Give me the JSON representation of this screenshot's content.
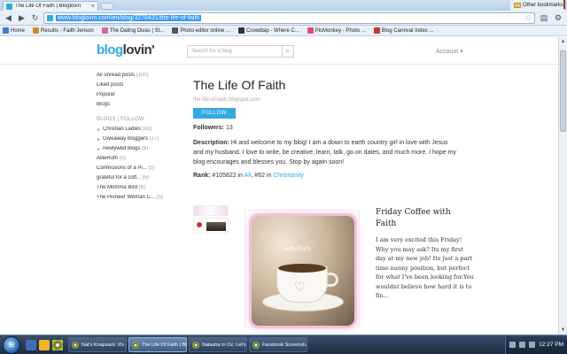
{
  "browser": {
    "tab_title": "The Life Of Faith | Bloglovin",
    "url": "www.bloglovin.com/en/blog/3278431/the-life-of-faith",
    "bookmarks": [
      {
        "label": "Home",
        "color": "#3b7bd6"
      },
      {
        "label": "Results - Faith Jenson",
        "color": "#d0892b"
      },
      {
        "label": "The Dating Divas | St...",
        "color": "#c86ea0"
      },
      {
        "label": "Photo editor online ...",
        "color": "#555555"
      },
      {
        "label": "Crowdtap - Where C...",
        "color": "#333333"
      },
      {
        "label": "PicMonkey - Photo ...",
        "color": "#e24a7a"
      },
      {
        "label": "Blog Carnival Index ...",
        "color": "#c0392b"
      }
    ],
    "other_bookmarks": "Other bookmarks"
  },
  "header": {
    "logo_part1": "blog",
    "logo_part2": "lovin'",
    "search_placeholder": "Search for a blog",
    "account": "Account ▾"
  },
  "sidebar": {
    "items": [
      {
        "label": "All unread posts",
        "count": "(100)"
      },
      {
        "label": "Liked posts",
        "count": ""
      },
      {
        "label": "Popular",
        "count": ""
      },
      {
        "label": "Blogs",
        "count": ""
      }
    ],
    "section_title": "BLOGS | FOLLOW",
    "folders": [
      {
        "label": "Christian Ladies",
        "count": "(63)"
      },
      {
        "label": "Giveaway bloggers",
        "count": "(17)"
      },
      {
        "label": "newlywed blogs",
        "count": "(6)"
      }
    ],
    "blogs": [
      {
        "label": "AllieRuth",
        "count": "(5)"
      },
      {
        "label": "Confessions of a Pi...",
        "count": "(5)"
      },
      {
        "label": "grateful for a coff...",
        "count": "(5)"
      },
      {
        "label": "The Momma Bird",
        "count": "(6)"
      },
      {
        "label": "The Pioneer Woman C...",
        "count": "(5)"
      }
    ]
  },
  "blog": {
    "title": "The Life Of Faith",
    "url": "the-life-of-faith.blogspot.com",
    "follow_label": "FOLLOW",
    "followers_label": "Followers:",
    "followers_count": "13",
    "description_label": "Description:",
    "description": "Hi and welcome to my blog! I am a down to earth country girl in love with Jesus and my husband. I love to write, be creative, learn, talk, go on dates, and much more. I hope my blog encourages and blesses you. Stop by again soon!",
    "rank_label": "Rank:",
    "rank_value": "#105822 in",
    "rank_all": "All",
    "rank_sep": ", #62 in",
    "rank_category": "Christianity"
  },
  "post": {
    "image_caption": "with Faith",
    "title": "Friday Coffee with Faith",
    "excerpt": "I am very excited this Friday! Why you may ask? Its my first day at my new job! Its just a part time nanny position, but perfect for what I've been looking for.You wouldnt believe how hard it is to fin..."
  },
  "taskbar": {
    "tasks": [
      "Nat's Knapsack: It's a...",
      "The Life Of Faith | Bl...",
      "Natasha In Oz: Let's ...",
      "Facebook Screensh..."
    ],
    "clock": "12:27 PM"
  }
}
